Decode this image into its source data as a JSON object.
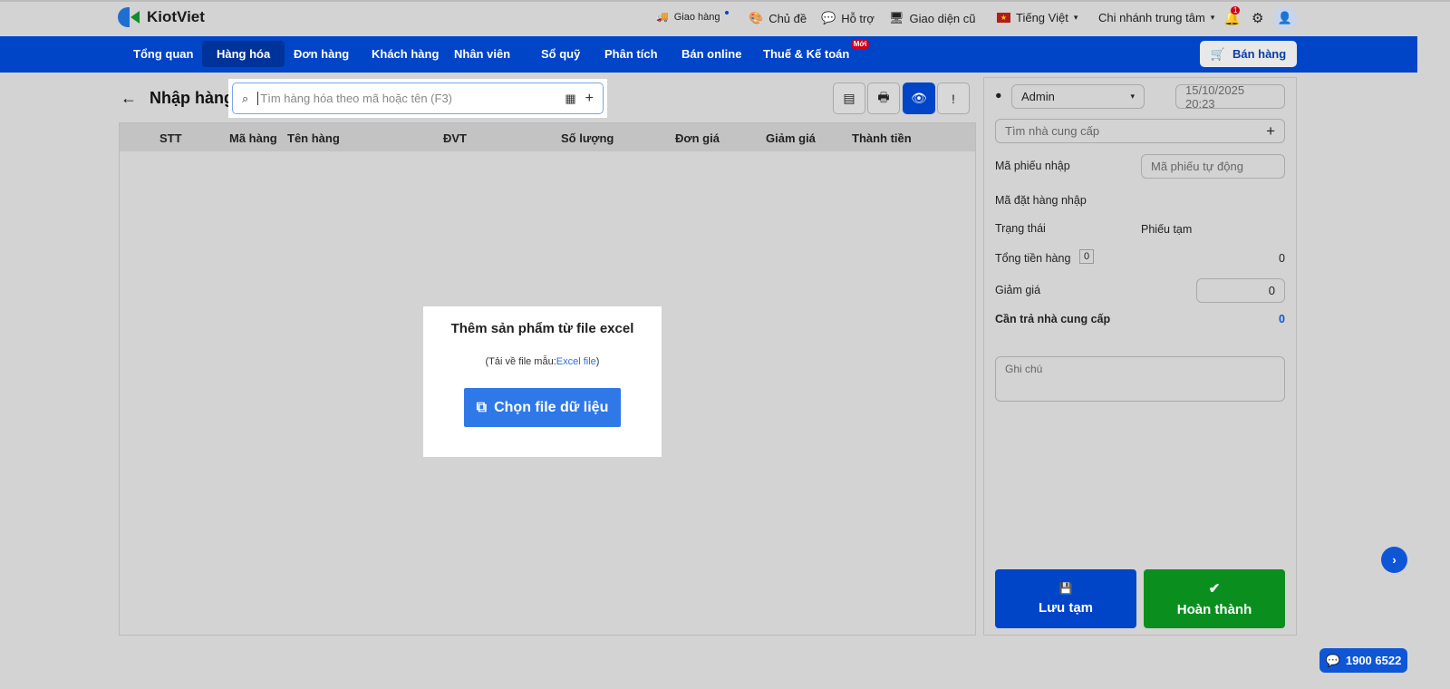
{
  "brand": {
    "name": "KiotViet"
  },
  "topbar": {
    "delivery": "Giao hàng",
    "theme": "Chủ đề",
    "support": "Hỗ trợ",
    "old_ui": "Giao diện cũ",
    "language": "Tiếng Việt",
    "branch": "Chi nhánh trung tâm",
    "notifications": "1"
  },
  "nav": {
    "items": [
      "Tổng quan",
      "Hàng hóa",
      "Đơn hàng",
      "Khách hàng",
      "Nhân viên",
      "Sổ quỹ",
      "Phân tích",
      "Bán online",
      "Thuế & Kế toán"
    ],
    "active": "Hàng hóa",
    "new_badge": "Mới",
    "sell_button": "Bán hàng"
  },
  "page": {
    "title": "Nhập hàng",
    "search_placeholder": "Tìm hàng hóa theo mã hoặc tên (F3)"
  },
  "table": {
    "headers": [
      "STT",
      "Mã hàng",
      "Tên hàng",
      "ĐVT",
      "Số lượng",
      "Đơn giá",
      "Giảm giá",
      "Thành tiền"
    ]
  },
  "import_modal": {
    "title": "Thêm sản phẩm từ file excel",
    "download_prefix": "(Tải về file mẫu:",
    "download_link": "Excel file",
    "download_suffix": ")",
    "choose_button": "Chọn file dữ liệu"
  },
  "side": {
    "user": "Admin",
    "datetime": "15/10/2025 20:23",
    "supplier_placeholder": "Tìm nhà cung cấp",
    "receipt_code_label": "Mã phiếu nhập",
    "receipt_code_placeholder": "Mã phiếu tự động",
    "order_code_label": "Mã đặt hàng nhập",
    "status_label": "Trạng thái",
    "status_value": "Phiếu tạm",
    "total_label": "Tổng tiền hàng",
    "total_count": "0",
    "total_value": "0",
    "discount_label": "Giảm giá",
    "discount_value": "0",
    "payable_label": "Cần trả nhà cung cấp",
    "payable_value": "0",
    "note_placeholder": "Ghi chú",
    "save_draft": "Lưu tạm",
    "complete": "Hoàn thành"
  },
  "hotline": "1900 6522",
  "colors": {
    "nav": "#0044c8",
    "primary": "#0f56d6",
    "success": "#0a8f1f",
    "excel_button": "#2f78e8"
  }
}
